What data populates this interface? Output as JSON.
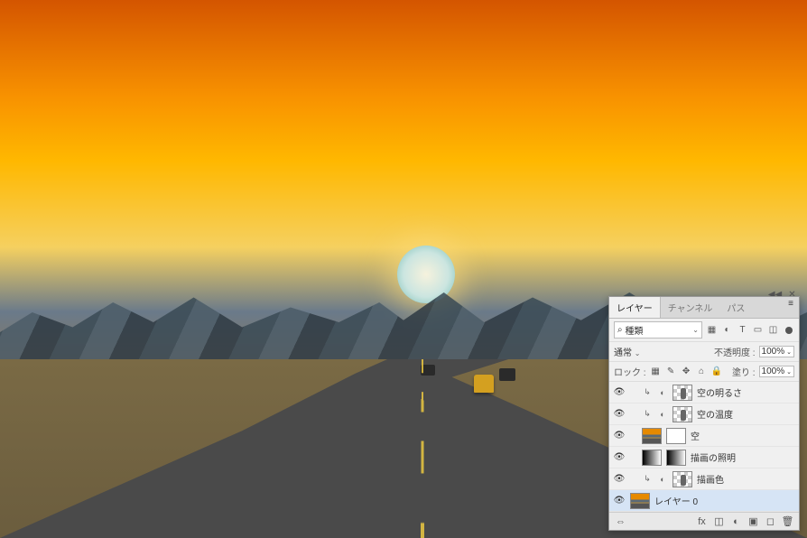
{
  "collapse": {
    "dbl_arrow": "◀◀",
    "close": "✕"
  },
  "tabs": {
    "layers": "レイヤー",
    "channels": "チャンネル",
    "paths": "パス"
  },
  "filter_row": {
    "search_icon": "⌕",
    "kind_label": "種類",
    "icons": [
      "▦",
      "◐",
      "T",
      "▭",
      "◫"
    ]
  },
  "blend_row": {
    "mode": "通常",
    "opacity_label": "不透明度 :",
    "opacity_value": "100%"
  },
  "lock_row": {
    "label": "ロック :",
    "icons": [
      "▦",
      "✎",
      "✥",
      "⌂",
      "🔒"
    ],
    "fill_label": "塗り :",
    "fill_value": "100%"
  },
  "layers": [
    {
      "name": "空の明るさ",
      "eye": true,
      "indent": true,
      "link": true,
      "adj": true,
      "thumb": "checker"
    },
    {
      "name": "空の温度",
      "eye": true,
      "indent": true,
      "link": true,
      "adj": true,
      "thumb": "checker"
    },
    {
      "name": "空",
      "eye": true,
      "indent": true,
      "thumb": "img",
      "mask": "mask-w"
    },
    {
      "name": "描画の照明",
      "eye": true,
      "indent": true,
      "thumb": "grad",
      "mask": "mask-g"
    },
    {
      "name": "描画色",
      "eye": true,
      "indent": true,
      "link": true,
      "adj": true,
      "thumb": "checker"
    },
    {
      "name": "レイヤー 0",
      "eye": true,
      "indent": false,
      "thumb": "img",
      "selected": true
    }
  ],
  "footer": {
    "icons": [
      "⇔",
      "fx",
      "◫",
      "◐",
      "▣",
      "◻",
      "🗑"
    ]
  }
}
